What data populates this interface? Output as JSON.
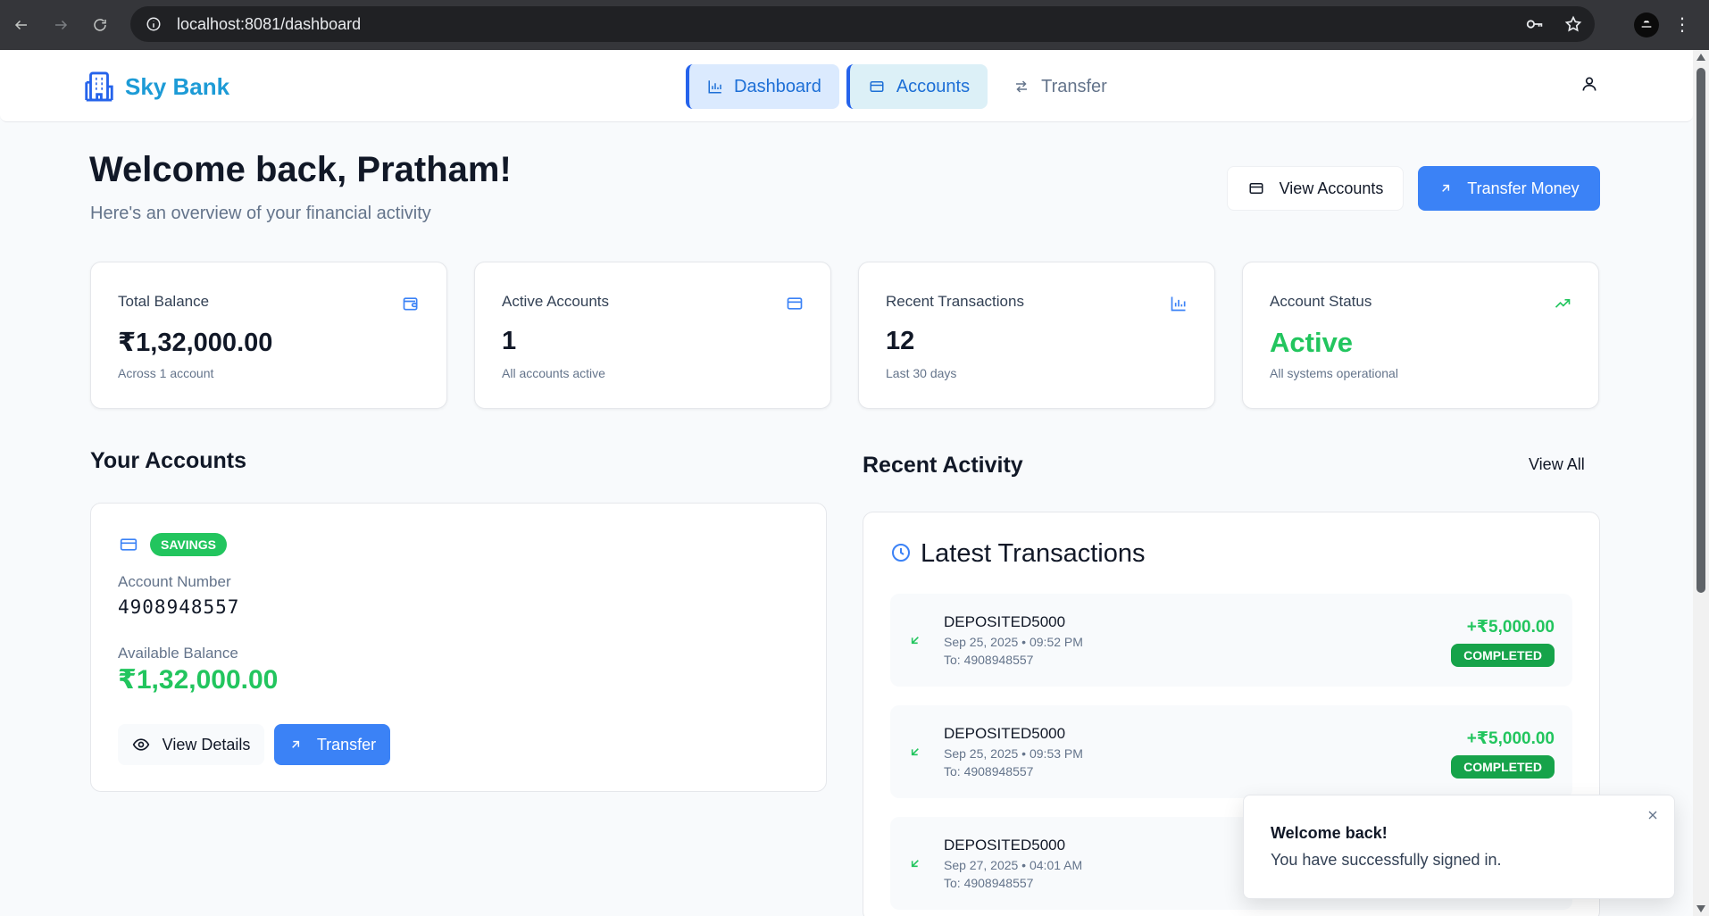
{
  "browser": {
    "url": "localhost:8081/dashboard"
  },
  "header": {
    "brand": "Sky Bank",
    "nav": [
      {
        "label": "Dashboard",
        "icon": "bar-chart-icon"
      },
      {
        "label": "Accounts",
        "icon": "card-icon"
      },
      {
        "label": "Transfer",
        "icon": "arrows-swap-icon"
      }
    ]
  },
  "welcome": {
    "title": "Welcome back, Pratham!",
    "subtitle": "Here's an overview of your financial activity",
    "view_accounts_label": "View Accounts",
    "transfer_money_label": "Transfer Money"
  },
  "stats": [
    {
      "label": "Total Balance",
      "value": "₹1,32,000.00",
      "note": "Across 1 account",
      "icon": "wallet-icon"
    },
    {
      "label": "Active Accounts",
      "value": "1",
      "note": "All accounts active",
      "icon": "card-icon"
    },
    {
      "label": "Recent Transactions",
      "value": "12",
      "note": "Last 30 days",
      "icon": "bar-chart-icon"
    },
    {
      "label": "Account Status",
      "value": "Active",
      "note": "All systems operational",
      "icon": "trend-up-icon"
    }
  ],
  "accounts_section": {
    "title": "Your Accounts",
    "account": {
      "type": "SAVINGS",
      "number_label": "Account Number",
      "number": "4908948557",
      "balance_label": "Available Balance",
      "balance": "₹1,32,000.00",
      "view_details_label": "View Details",
      "transfer_label": "Transfer"
    }
  },
  "activity": {
    "title": "Recent Activity",
    "view_all_label": "View All",
    "card_title": "Latest Transactions",
    "transactions": [
      {
        "desc": "DEPOSITED5000",
        "date": "Sep 25, 2025 • 09:52 PM",
        "to": "To: 4908948557",
        "amount": "+₹5,000.00",
        "status": "COMPLETED"
      },
      {
        "desc": "DEPOSITED5000",
        "date": "Sep 25, 2025 • 09:53 PM",
        "to": "To: 4908948557",
        "amount": "+₹5,000.00",
        "status": "COMPLETED"
      },
      {
        "desc": "DEPOSITED5000",
        "date": "Sep 27, 2025 • 04:01 AM",
        "to": "To: 4908948557",
        "amount": "",
        "status": ""
      }
    ]
  },
  "toast": {
    "title": "Welcome back!",
    "message": "You have successfully signed in."
  },
  "colors": {
    "primary": "#3b82f6",
    "brand": "#1d9bd6",
    "success": "#22c55e"
  }
}
